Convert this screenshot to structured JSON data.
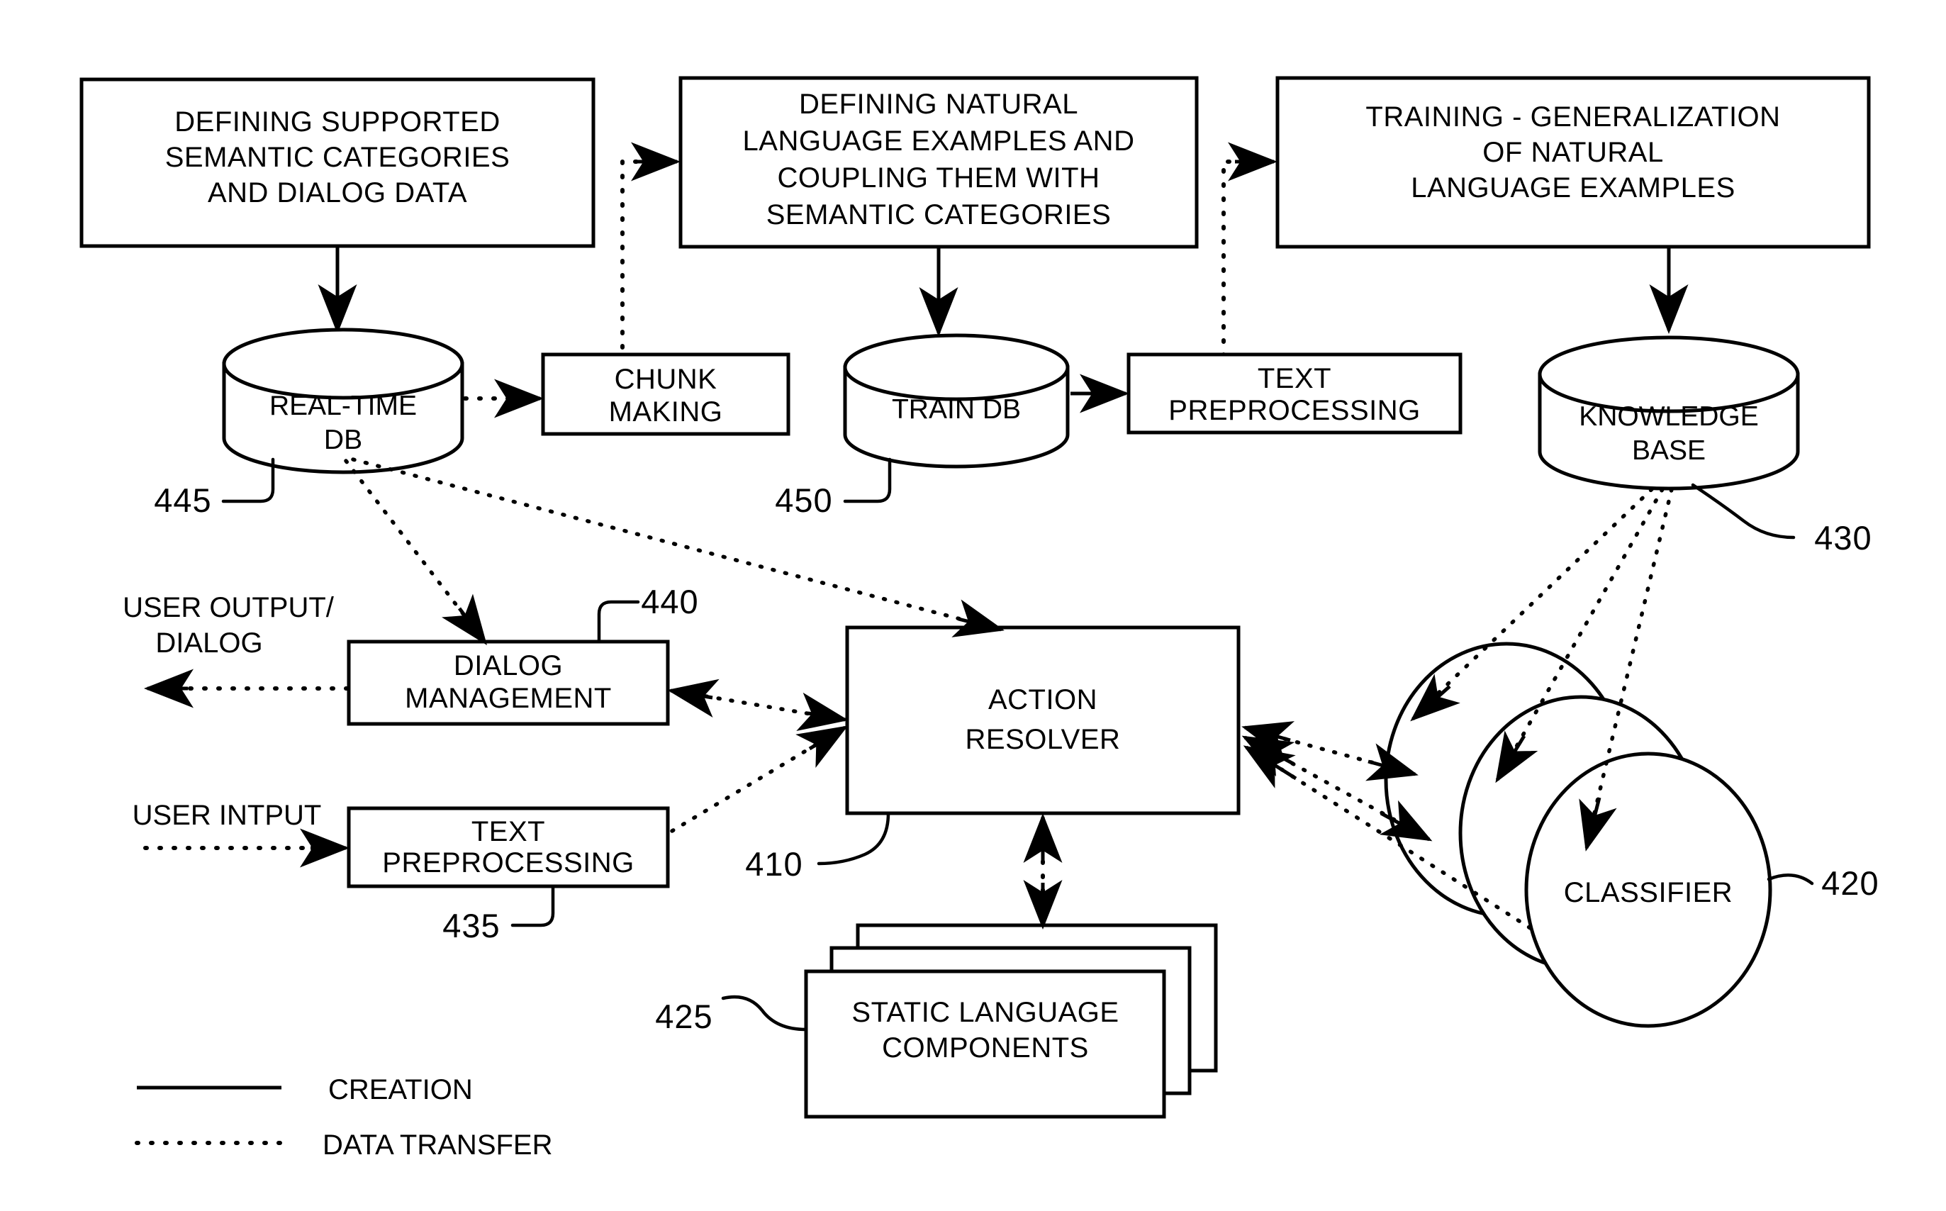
{
  "figure": {
    "type": "patent-flow-diagram",
    "background": "#ffffff",
    "ink": "#000000"
  },
  "process_boxes": {
    "defining_categories": {
      "lines": [
        "DEFINING SUPPORTED",
        "SEMANTIC CATEGORIES",
        "AND DIALOG DATA"
      ]
    },
    "defining_examples": {
      "lines": [
        "DEFINING NATURAL",
        "LANGUAGE  EXAMPLES AND",
        "COUPLING THEM WITH",
        "SEMANTIC CATEGORIES"
      ]
    },
    "training": {
      "lines": [
        "TRAINING - GENERALIZATION",
        "OF NATURAL",
        "LANGUAGE EXAMPLES"
      ]
    },
    "chunk_making": {
      "lines": [
        "CHUNK",
        "MAKING"
      ]
    },
    "text_preprocessing_train": {
      "lines": [
        "TEXT",
        "PREPROCESSING"
      ]
    },
    "dialog_management": {
      "lines": [
        "DIALOG",
        "MANAGEMENT"
      ],
      "ref": "440"
    },
    "text_preprocessing_user": {
      "lines": [
        "TEXT",
        "PREPROCESSING"
      ],
      "ref": "435"
    },
    "action_resolver": {
      "lines": [
        "ACTION",
        "RESOLVER"
      ],
      "ref": "410"
    },
    "static_language_components": {
      "lines": [
        "STATIC LANGUAGE",
        "COMPONENTS"
      ],
      "ref": "425"
    }
  },
  "databases": {
    "realtime_db": {
      "lines": [
        "REAL-TIME",
        "DB"
      ],
      "ref": "445"
    },
    "train_db": {
      "lines": [
        "TRAIN DB"
      ],
      "ref": "450"
    },
    "knowledge_base": {
      "lines": [
        "KNOWLEDGE",
        "BASE"
      ],
      "ref": "430"
    }
  },
  "classifier": {
    "label": "CLASSIFIER",
    "ref": "420",
    "count": 3
  },
  "io_labels": {
    "user_output": [
      "USER OUTPUT/",
      "DIALOG"
    ],
    "user_input": "USER INTPUT"
  },
  "legend": {
    "creation": "CREATION",
    "data_transfer": "DATA TRANSFER"
  }
}
